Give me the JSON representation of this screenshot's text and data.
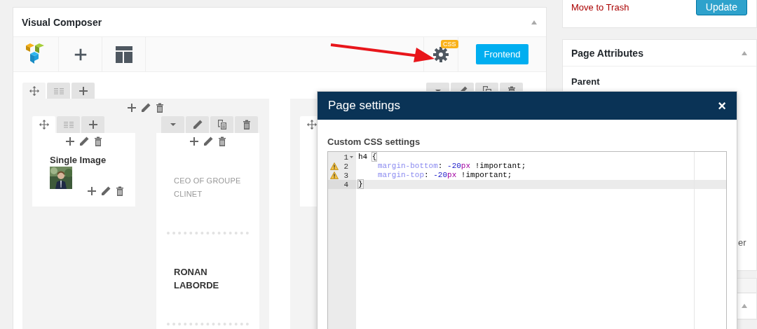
{
  "publish": {
    "trash_link": "Move to Trash",
    "update_button": "Update"
  },
  "composer": {
    "title": "Visual Composer",
    "css_badge": "CSS",
    "frontend_button": "Frontend",
    "rows": [
      {
        "columns": [
          {
            "title": "Single Image"
          },
          {
            "kind": "text",
            "subtitle": "CEO OF GROUPE CLINET",
            "name": "RONAN LABORDE"
          }
        ]
      },
      {
        "columns": [
          {
            "kind": "empty"
          }
        ]
      }
    ]
  },
  "page_attributes": {
    "title": "Page Attributes",
    "parent_label": "Parent",
    "cut_text": "er"
  },
  "modal": {
    "title": "Page settings",
    "close": "×",
    "section_label": "Custom CSS settings",
    "code_lines": [
      {
        "number": "1",
        "fold": true,
        "warning": false,
        "active": false,
        "indent": false,
        "tokens": [
          {
            "kind": "selector",
            "text": "h4 "
          },
          {
            "kind": "bracket",
            "text": "{"
          }
        ]
      },
      {
        "number": "2",
        "fold": false,
        "warning": true,
        "active": false,
        "indent": true,
        "tokens": [
          {
            "kind": "property",
            "text": "margin-bottom"
          },
          {
            "kind": "plain",
            "text": ": "
          },
          {
            "kind": "number",
            "text": "-20"
          },
          {
            "kind": "unit",
            "text": "px"
          },
          {
            "kind": "plain",
            "text": " !important;"
          }
        ]
      },
      {
        "number": "3",
        "fold": false,
        "warning": true,
        "active": false,
        "indent": true,
        "tokens": [
          {
            "kind": "property",
            "text": "margin-top"
          },
          {
            "kind": "plain",
            "text": ": "
          },
          {
            "kind": "number",
            "text": "-20"
          },
          {
            "kind": "unit",
            "text": "px"
          },
          {
            "kind": "plain",
            "text": " !important;"
          }
        ]
      },
      {
        "number": "4",
        "fold": false,
        "warning": false,
        "active": true,
        "indent": false,
        "tokens": [
          {
            "kind": "bracket",
            "text": "}"
          }
        ]
      }
    ]
  }
}
